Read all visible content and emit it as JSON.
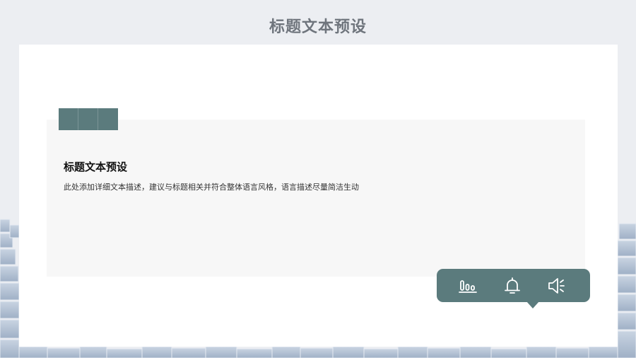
{
  "page": {
    "title": "标题文本预设"
  },
  "content": {
    "heading": "标题文本预设",
    "description": "此处添加详细文本描述，建议与标题相关并符合整体语言风格，语言描述尽量简洁生动"
  },
  "toolbar": {
    "buttons": [
      {
        "icon": "bar-chart-icon"
      },
      {
        "icon": "bell-icon"
      },
      {
        "icon": "speaker-icon"
      }
    ]
  },
  "colors": {
    "accent": "#5b7b7d",
    "panel": "#f7f7f7",
    "title": "#6f757d",
    "background": "#eceef2"
  }
}
